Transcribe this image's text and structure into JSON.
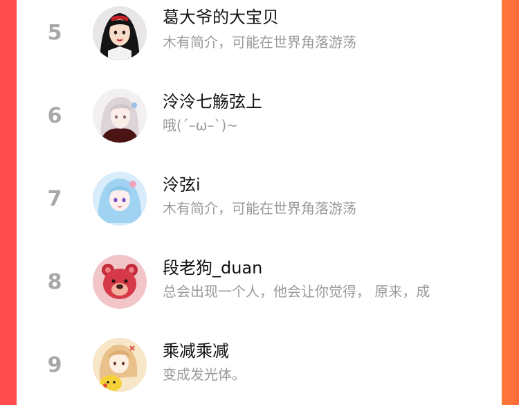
{
  "ranking": {
    "items": [
      {
        "rank": "5",
        "name": "葛大爷的大宝贝",
        "bio": "木有简介，可能在世界角落游荡",
        "avatar_icon": "snow-white-avatar-icon"
      },
      {
        "rank": "6",
        "name": "泠泠七觞弦上",
        "bio": "哦(´–ω–`)~",
        "avatar_icon": "silver-hair-girl-avatar-icon"
      },
      {
        "rank": "7",
        "name": "泠弦i",
        "bio": "木有简介，可能在世界角落游荡",
        "avatar_icon": "blue-hair-anime-avatar-icon"
      },
      {
        "rank": "8",
        "name": "段老狗_duan",
        "bio": "总会出现一个人，他会让你觉得，  原来，成",
        "avatar_icon": "pink-bear-avatar-icon"
      },
      {
        "rank": "9",
        "name": "乘减乘减",
        "bio": "变成发光体。",
        "avatar_icon": "pikachu-girl-avatar-icon"
      }
    ]
  },
  "colors": {
    "left_edge": "#ff4b4b",
    "right_edge": "#ff7a37",
    "rank_gray": "#a8a8a8",
    "name_black": "#111111",
    "bio_gray": "#9a9a9a"
  }
}
